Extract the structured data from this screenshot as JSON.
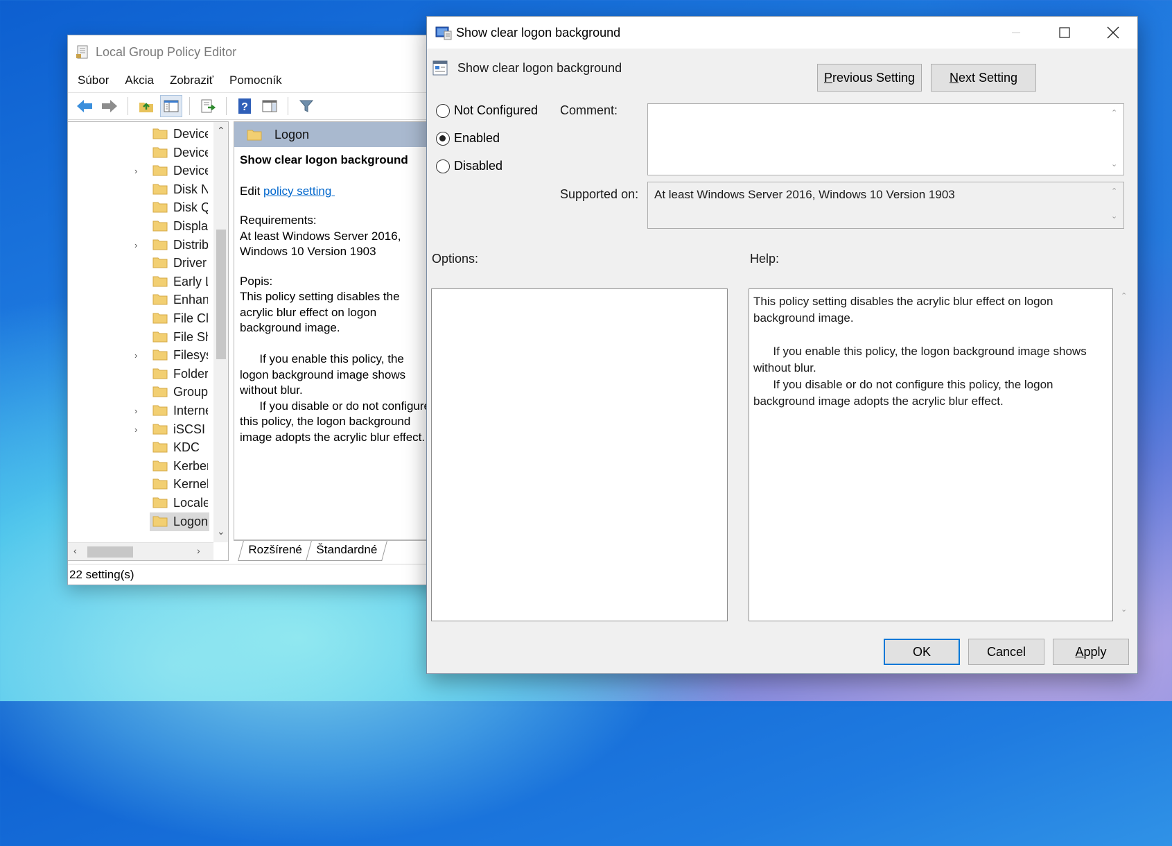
{
  "gpe": {
    "title": "Local Group Policy Editor",
    "menu": [
      "Súbor",
      "Akcia",
      "Zobraziť",
      "Pomocník"
    ],
    "tree": [
      {
        "label": "Device",
        "expandable": false
      },
      {
        "label": "Device",
        "expandable": false
      },
      {
        "label": "Device",
        "expandable": true
      },
      {
        "label": "Disk N'",
        "expandable": false
      },
      {
        "label": "Disk Q",
        "expandable": false
      },
      {
        "label": "Display",
        "expandable": false
      },
      {
        "label": "Distrib",
        "expandable": true
      },
      {
        "label": "Driver",
        "expandable": false
      },
      {
        "label": "Early L",
        "expandable": false
      },
      {
        "label": "Enhanc",
        "expandable": false
      },
      {
        "label": "File Cla",
        "expandable": false
      },
      {
        "label": "File Sh",
        "expandable": false
      },
      {
        "label": "Filesys",
        "expandable": true
      },
      {
        "label": "Folder",
        "expandable": false
      },
      {
        "label": "Group",
        "expandable": false
      },
      {
        "label": "Interne",
        "expandable": true
      },
      {
        "label": "iSCSI",
        "expandable": true
      },
      {
        "label": "KDC",
        "expandable": false
      },
      {
        "label": "Kerber",
        "expandable": false
      },
      {
        "label": "Kernel",
        "expandable": false
      },
      {
        "label": "Locale",
        "expandable": false
      },
      {
        "label": "Logon",
        "expandable": false,
        "selected": true
      }
    ],
    "extended": {
      "header": "Logon",
      "setting_title": "Show clear logon background",
      "edit_prefix": "Edit ",
      "edit_link": "policy setting ",
      "requirements_label": "Requirements:",
      "requirements": "At least Windows Server 2016, Windows 10 Version 1903",
      "description_label": "Popis:",
      "description": "This policy setting disables the acrylic blur effect on logon background image.\n\n      If you enable this policy, the logon background image shows without blur.\n      If you disable or do not configure this policy, the logon background image adopts the acrylic blur effect."
    },
    "tabs": [
      "Rozšírené",
      "Štandardné"
    ],
    "status": "22 setting(s)"
  },
  "dialog": {
    "title": "Show clear logon background",
    "header": "Show clear logon background",
    "prev_button": "Previous Setting",
    "next_button": "Next Setting",
    "radios": {
      "not_configured": "Not Configured",
      "enabled": "Enabled",
      "disabled": "Disabled",
      "selected": "enabled"
    },
    "comment_label": "Comment:",
    "comment_value": "",
    "supported_label": "Supported on:",
    "supported_value": "At least Windows Server 2016, Windows 10 Version 1903",
    "options_label": "Options:",
    "help_label": "Help:",
    "help_text": "This policy setting disables the acrylic blur effect on logon background image.\n\n      If you enable this policy, the logon background image shows without blur.\n      If you disable or do not configure this policy, the logon background image adopts the acrylic blur effect.",
    "ok": "OK",
    "cancel": "Cancel",
    "apply": "Apply"
  }
}
